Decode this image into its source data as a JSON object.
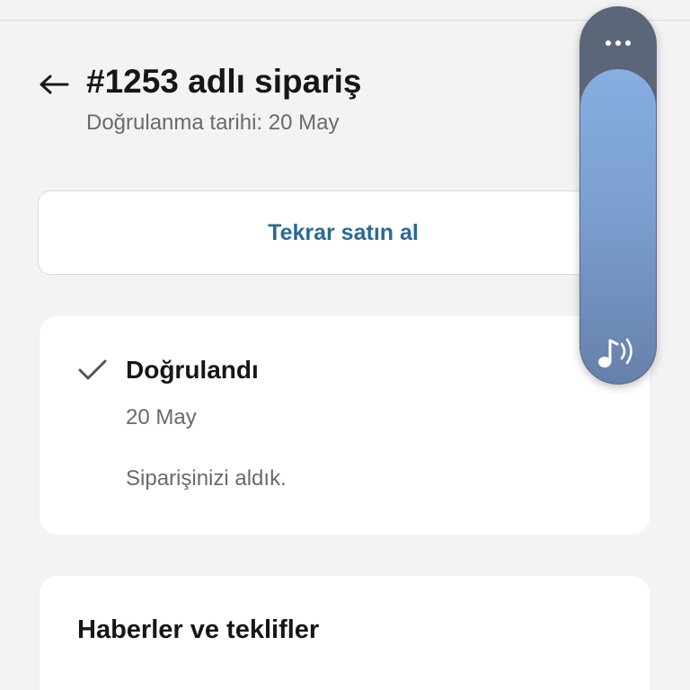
{
  "header": {
    "back_icon": "arrow-left-icon",
    "title": "#1253 adlı sipariş",
    "subtitle": "Doğrulanma tarihi: 20 May"
  },
  "actions": {
    "rebuy_label": "Tekrar satın al"
  },
  "status_card": {
    "icon": "checkmark-icon",
    "title": "Doğrulandı",
    "date": "20 May",
    "message": "Siparişinizi aldık."
  },
  "news_card": {
    "title": "Haberler ve teklifler"
  },
  "overlay": {
    "menu_icon": "more-horizontal-icon",
    "audio_icon": "music-note-sound-icon"
  },
  "colors": {
    "background": "#f3f3f3",
    "accent_link": "#2a6a94",
    "overlay_dark": "#5b6678",
    "overlay_light": "#86aee0"
  }
}
